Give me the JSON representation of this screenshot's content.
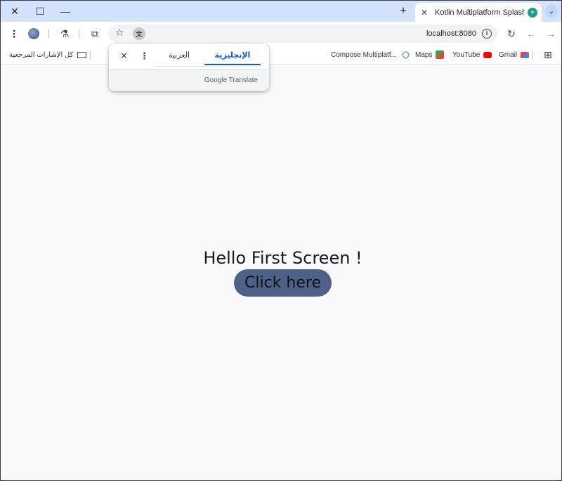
{
  "tabstrip": {
    "close_glyph": "✕",
    "maximize_glyph": "☐",
    "minimize_glyph": "—",
    "newtab_glyph": "+",
    "tab_title": "Kotlin Multiplatform Splash Scre",
    "tab_close_glyph": "✕",
    "search_tabs_glyph": "⌄"
  },
  "toolbar": {
    "menu_glyph": "⋮",
    "labs_glyph": "⚗",
    "extensions_glyph": "⧉",
    "star_glyph": "☆",
    "translate_glyph": "文",
    "url": "localhost:8080",
    "site_info_glyph": "i",
    "reload_glyph": "↻",
    "back_glyph": "←",
    "forward_glyph": "→"
  },
  "bookmarks": {
    "all_bookmarks": "كل الإشارات المرجعية",
    "items": [
      {
        "label": "Compose Multiplatf...",
        "icon": "compose-icon",
        "color": "#4285f4"
      },
      {
        "label": "Maps",
        "icon": "maps-icon",
        "color": "#34a853"
      },
      {
        "label": "YouTube",
        "icon": "youtube-icon",
        "color": "#ff0000"
      },
      {
        "label": "Gmail",
        "icon": "gmail-icon",
        "color": "#ea4335"
      }
    ],
    "apps_glyph": "⊞"
  },
  "translate_popup": {
    "close_glyph": "✕",
    "more_glyph": "⋮",
    "lang_source": "العربية",
    "lang_target": "الإنجليزية",
    "brand_google": "Google",
    "brand_translate": "Translate",
    "accent": "#0b57d0"
  },
  "content": {
    "heading": "Hello First Screen !",
    "button_label": "Click here",
    "button_color": "#4e6189"
  }
}
